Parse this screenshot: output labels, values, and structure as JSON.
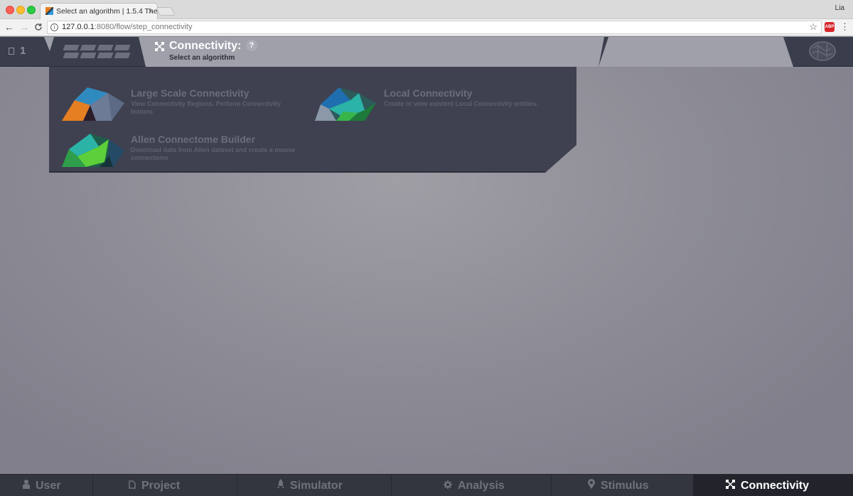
{
  "browser": {
    "tab_title": "Select an algorithm | 1.5.4 The",
    "tab_close": "×",
    "profile_name": "Lia",
    "url_host": "127.0.0.1",
    "url_rest": ":8080/flow/step_connectivity",
    "nav_back": "←",
    "nav_forward": "→",
    "nav_reload": "C",
    "info_icon": "i",
    "star_icon": "☆",
    "abp_label": "ABP",
    "menu_icon": "⋮"
  },
  "header": {
    "project_count": "1",
    "title": "Connectivity:",
    "help": "?",
    "subtitle": "Select an algorithm"
  },
  "algorithms": [
    {
      "title": "Large Scale Connectivity",
      "description": "View Connectivity Regions. Perform Connectivity lesions"
    },
    {
      "title": "Local Connectivity",
      "description": "Create or view existent Local Connectivity entities."
    },
    {
      "title": "Allen Connectome Builder",
      "description": "Download data from Allen dataset and create a mouse connectome"
    }
  ],
  "bottom_nav": [
    {
      "label": "User",
      "icon": "user-icon",
      "active": false
    },
    {
      "label": "Project",
      "icon": "project-icon",
      "active": false
    },
    {
      "label": "Simulator",
      "icon": "rocket-icon",
      "active": false
    },
    {
      "label": "Analysis",
      "icon": "gear-icon",
      "active": false
    },
    {
      "label": "Stimulus",
      "icon": "map-pin-icon",
      "active": false
    },
    {
      "label": "Connectivity",
      "icon": "connectivity-icon",
      "active": true
    }
  ],
  "colors": {
    "header_bg": "#3a3d4b",
    "panel_bg": "#3f4150",
    "title_bar_bg": "#9fa0aa",
    "active_nav_text": "#ffffff"
  }
}
